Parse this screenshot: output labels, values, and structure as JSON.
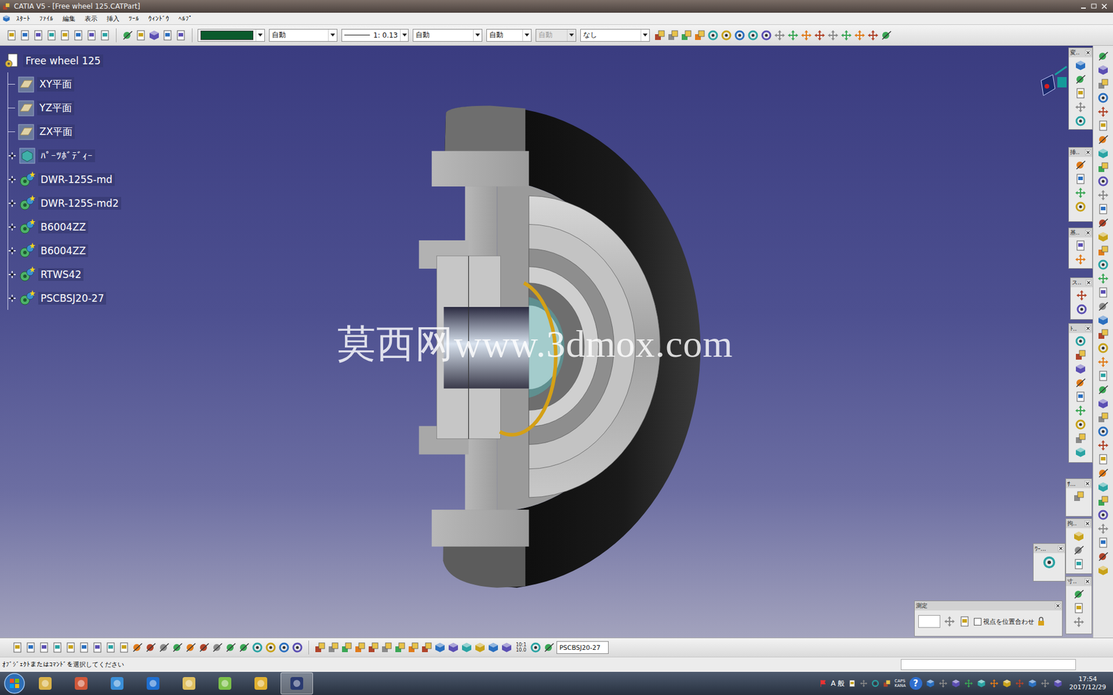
{
  "window": {
    "title": "CATIA V5 - [Free wheel 125.CATPart]"
  },
  "menu": [
    "ｽﾀｰﾄ",
    "ﾌｧｲﾙ",
    "編集",
    "表示",
    "挿入",
    "ﾂｰﾙ",
    "ｳｨﾝﾄﾞｳ",
    "ﾍﾙﾌﾟ"
  ],
  "toolbar": {
    "color": "#0b5a2c",
    "dropdowns": [
      {
        "value": "自動",
        "disabled": false
      },
      {
        "value": "1: 0.13",
        "disabled": false,
        "kind": "line"
      },
      {
        "value": "自動",
        "disabled": false
      },
      {
        "value": "自動",
        "disabled": false
      },
      {
        "value": "自動",
        "disabled": true
      },
      {
        "value": "なし",
        "disabled": false
      }
    ]
  },
  "tree": {
    "root": "Free wheel 125",
    "items": [
      {
        "label": "XY平面",
        "kind": "plane",
        "expandable": false,
        "expanded": false
      },
      {
        "label": "YZ平面",
        "kind": "plane",
        "expandable": false,
        "expanded": false
      },
      {
        "label": "ZX平面",
        "kind": "plane",
        "expandable": false,
        "expanded": false
      },
      {
        "label": "ﾊﾟｰﾂﾎﾞﾃﾞｨｰ",
        "kind": "body",
        "expandable": true,
        "expanded": false
      },
      {
        "label": "DWR-125S-md",
        "kind": "part",
        "expandable": true,
        "expanded": false
      },
      {
        "label": "DWR-125S-md2",
        "kind": "part",
        "expandable": true,
        "expanded": false
      },
      {
        "label": "B6004ZZ",
        "kind": "part",
        "expandable": true,
        "expanded": false
      },
      {
        "label": "B6004ZZ",
        "kind": "part",
        "expandable": true,
        "expanded": false
      },
      {
        "label": "RTWS42",
        "kind": "part",
        "expandable": true,
        "expanded": false
      },
      {
        "label": "PSCBSJ20-27",
        "kind": "part",
        "expandable": true,
        "expanded": false
      }
    ]
  },
  "watermark": "莫西网www.3dmox.com",
  "floating_toolbars": [
    {
      "title": "変.."
    },
    {
      "title": "挿.."
    },
    {
      "title": "基.."
    },
    {
      "title": "ス.."
    },
    {
      "title": "ﾄ.."
    },
    {
      "title": "ｻ..."
    },
    {
      "title": "拘.."
    },
    {
      "title": "寸.."
    }
  ],
  "workbench_panel": {
    "title": "ﾜｰ..."
  },
  "measure_panel": {
    "title": "測定",
    "checkbox": {
      "label": "視点を位置合わせ",
      "checked": false
    }
  },
  "bottom_toolbar": {
    "scale_label": [
      "10:1",
      "10.0"
    ],
    "field": "PSCBSJ20-27"
  },
  "status_bar": {
    "message": "ｵﾌﾞｼﾞｪｸﾄまたはｺﾏﾝﾄﾞを選択してください"
  },
  "taskbar": {
    "ime": "A 般",
    "caps": [
      "CAPS",
      "KANA"
    ],
    "help": "?",
    "time": "17:54",
    "date": "2017/12/29"
  }
}
